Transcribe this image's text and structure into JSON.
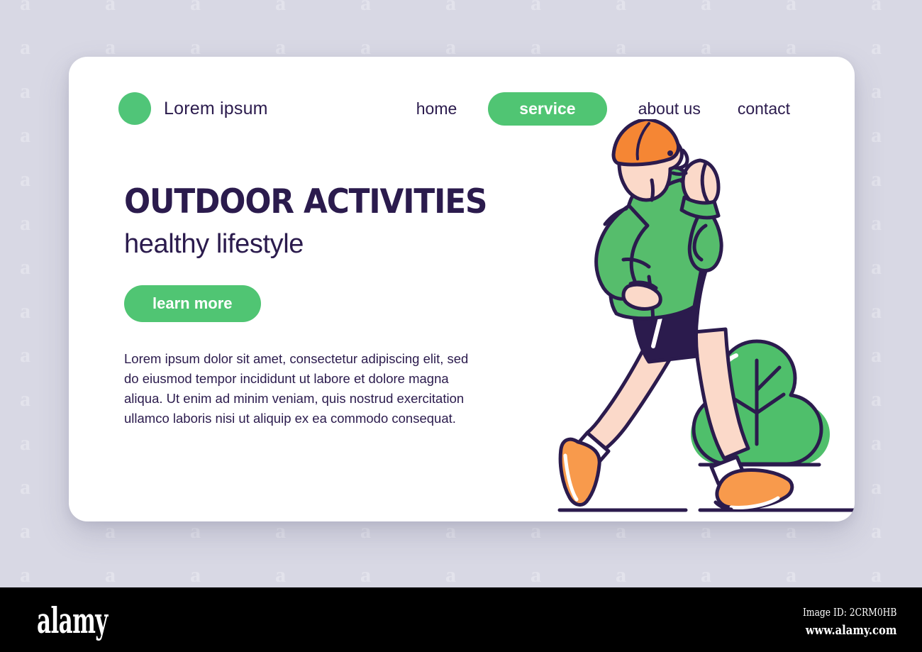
{
  "background": {
    "color": "#d8d8e4",
    "watermark_glyph": "a"
  },
  "card": {
    "background": "#ffffff"
  },
  "navbar": {
    "brand": {
      "logo_icon": "green-circle-icon",
      "name": "Lorem ipsum",
      "logo_color": "#50c578"
    },
    "links": [
      {
        "label": "home",
        "active": false
      },
      {
        "label": "service",
        "active": true
      },
      {
        "label": "about us",
        "active": false
      },
      {
        "label": "contact",
        "active": false
      }
    ],
    "active_pill_color": "#50c573",
    "link_color": "#2b1b4d"
  },
  "hero": {
    "headline": "OUTDOOR ACTIVITIES",
    "subheadline": "healthy lifestyle",
    "cta_label": "learn more",
    "cta_color": "#50c573",
    "body_text": "Lorem ipsum dolor sit amet, consectetur adipiscing elit, sed do eiusmod tempor incididunt ut labore et dolore magna aliqua. Ut enim ad minim veniam, quis nostrud exercitation ullamco laboris nisi ut aliquip ex ea commodo consequat.",
    "text_color": "#2b1b4d"
  },
  "illustration": {
    "name": "running-man-with-bush-illustration",
    "subject": "male runner in green jacket and orange beanie",
    "colors": {
      "outline": "#2b1b4d",
      "jacket_green": "#56bd6c",
      "beanie_orange": "#f58634",
      "shoe_orange": "#f89a4c",
      "skin": "#fbd9c9",
      "shorts_navy": "#2b1b4d",
      "bush_green": "#4fbf6b",
      "ground_line": "#2b1b4d"
    },
    "elements": [
      "beanie",
      "head",
      "jacket",
      "fist",
      "shorts",
      "legs",
      "shoes",
      "socks",
      "bush",
      "ground-line-left",
      "ground-line-right"
    ]
  },
  "footer": {
    "logo_text": "alamy",
    "image_id": "Image ID: 2CRM0HB",
    "url": "www.alamy.com",
    "background": "#000000"
  }
}
